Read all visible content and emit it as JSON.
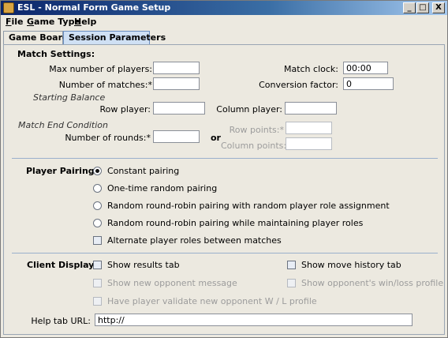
{
  "window": {
    "title": "ESL - Normal Form Game Setup",
    "min": "_",
    "max": "□",
    "close": "X"
  },
  "menu": [
    "File",
    "Game Type",
    "Help"
  ],
  "tabs": [
    "Game Board",
    "Session Parameters"
  ],
  "match": {
    "heading": "Match Settings:",
    "max_players_label": "Max number of players:",
    "max_players_value": "",
    "num_matches_label": "Number of matches:*",
    "num_matches_value": "",
    "match_clock_label": "Match clock:",
    "match_clock_value": "00:00",
    "conversion_label": "Conversion factor:",
    "conversion_value": "0",
    "starting_balance": "Starting Balance",
    "row_player_label": "Row player:",
    "row_player_value": "",
    "col_player_label": "Column player:",
    "col_player_value": "",
    "end_condition": "Match End Condition",
    "rounds_label": "Number of rounds:*",
    "rounds_value": "",
    "or": "or",
    "row_points_label": "Row points:*",
    "row_points_value": "",
    "col_points_label": "Column points:*",
    "col_points_value": ""
  },
  "pairing": {
    "heading": "Player Pairing:",
    "options": [
      "Constant pairing",
      "One-time random pairing",
      "Random round-robin pairing with random player role assignment",
      "Random round-robin pairing while maintaining player roles"
    ],
    "selected": 0,
    "alternate_label": "Alternate player roles between matches"
  },
  "client": {
    "heading": "Client Display:",
    "show_results": "Show results tab",
    "show_move_history": "Show move history tab",
    "show_new_opponent": "Show new opponent message",
    "show_opponent_wl": "Show opponent's win/loss profile",
    "validate_opponent": "Have player validate new opponent W / L profile",
    "help_url_label": "Help tab URL:",
    "help_url_value": "http://"
  }
}
